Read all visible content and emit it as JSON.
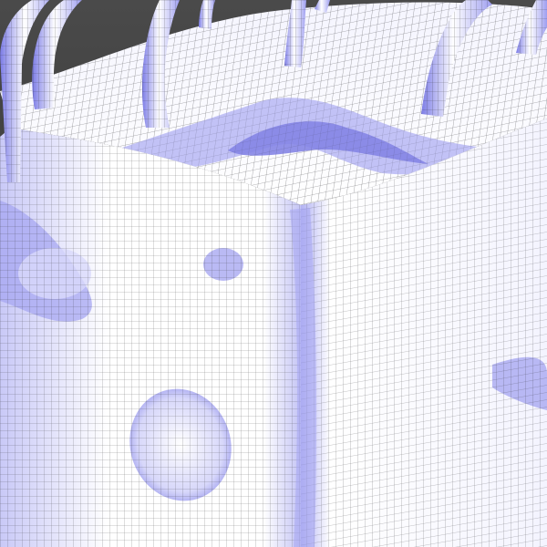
{
  "scene": {
    "subject": "sculpted-cube-wireframe-mesh",
    "background_color": "#3a3a3a",
    "mesh_base_color": "#ffffff",
    "mesh_shade_color": "#8f8ff0",
    "wire_color": "#222222"
  }
}
